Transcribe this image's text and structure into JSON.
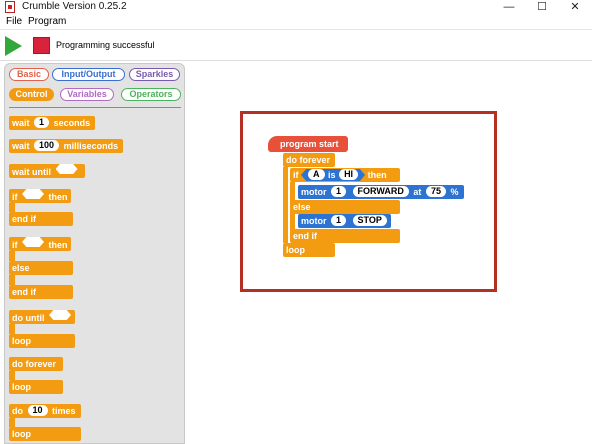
{
  "window": {
    "title": "Crumble Version 0.25.2",
    "minimize": "—",
    "maximize": "☐",
    "close": "✕"
  },
  "menu": {
    "file": "File",
    "program": "Program"
  },
  "toolbar": {
    "status": "Programming successful"
  },
  "palette": {
    "categories": {
      "basic": "Basic",
      "io": "Input/Output",
      "sparkles": "Sparkles",
      "control": "Control",
      "variables": "Variables",
      "operators": "Operators"
    },
    "blocks": {
      "wait_label": "wait",
      "wait_value": "1",
      "wait_unit": "seconds",
      "waitms_label": "wait",
      "waitms_value": "100",
      "waitms_unit": "milliseconds",
      "wait_until": "wait until",
      "if1_if": "if",
      "if1_then": "then",
      "if1_end": "end if",
      "if2_if": "if",
      "if2_then": "then",
      "if2_else": "else",
      "if2_end": "end if",
      "do_until": "do until",
      "do_until_loop": "loop",
      "do_forever": "do forever",
      "do_forever_loop": "loop",
      "do_times_do": "do",
      "do_times_value": "10",
      "do_times_times": "times",
      "do_times_loop": "loop"
    }
  },
  "script": {
    "program_start": "program start",
    "do_forever": "do forever",
    "if_label": "if",
    "cond_var": "A",
    "cond_is": "is",
    "cond_val": "HI",
    "then_label": "then",
    "motor1_label": "motor",
    "motor1_num": "1",
    "motor1_dir": "FORWARD",
    "motor1_at": "at",
    "motor1_speed": "75",
    "motor1_pct": "%",
    "else_label": "else",
    "motor2_label": "motor",
    "motor2_num": "1",
    "motor2_dir": "STOP",
    "end_if": "end if",
    "loop": "loop"
  },
  "colors": {
    "control": "#f39c12",
    "io": "#2c73d2",
    "start": "#e8503a",
    "highlight": "#b53023"
  }
}
